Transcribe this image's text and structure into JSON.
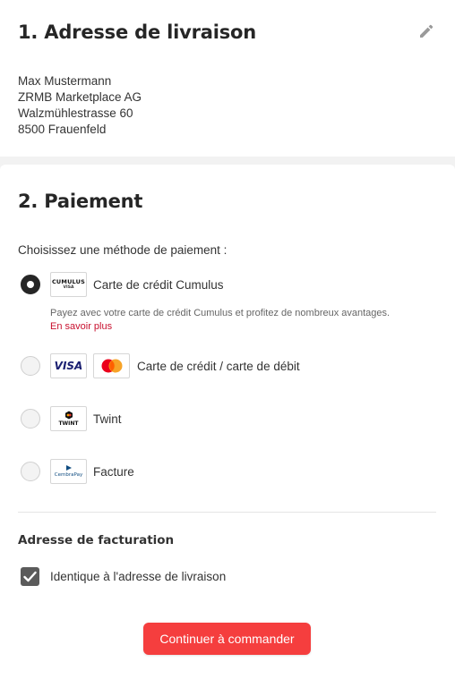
{
  "delivery": {
    "title": "1. Adresse de livraison",
    "address_lines": [
      "Max Mustermann",
      "ZRMB Marketplace AG",
      "Walzmühlestrasse 60",
      "8500 Frauenfeld"
    ],
    "edit_icon": "pencil-icon"
  },
  "payment": {
    "title": "2. Paiement",
    "choose_label": "Choisissez une méthode de paiement :",
    "options": [
      {
        "label": "Carte de crédit Cumulus",
        "selected": true,
        "logo_text": "CUMULUS",
        "logo_subtext": "VISA",
        "description": "Payez avec votre carte de crédit Cumulus et profitez de nombreux avantages.",
        "link": "En savoir plus"
      },
      {
        "label": "Carte de crédit / carte de débit",
        "selected": false,
        "logo_text": "VISA"
      },
      {
        "label": "Twint",
        "selected": false,
        "logo_text": "TWINT"
      },
      {
        "label": "Facture",
        "selected": false,
        "logo_text": "CembraPay"
      }
    ]
  },
  "billing": {
    "title": "Adresse de facturation",
    "same_as_delivery_label": "Identique à l'adresse de livraison",
    "same_as_delivery_checked": true
  },
  "actions": {
    "continue_label": "Continuer à commander"
  },
  "colors": {
    "accent": "#f53e3e",
    "link": "#c8102e",
    "visa_blue": "#1a1f71",
    "mastercard_red": "#eb001b",
    "mastercard_orange": "#f79e1b",
    "cembra_blue": "#0f4c81"
  }
}
